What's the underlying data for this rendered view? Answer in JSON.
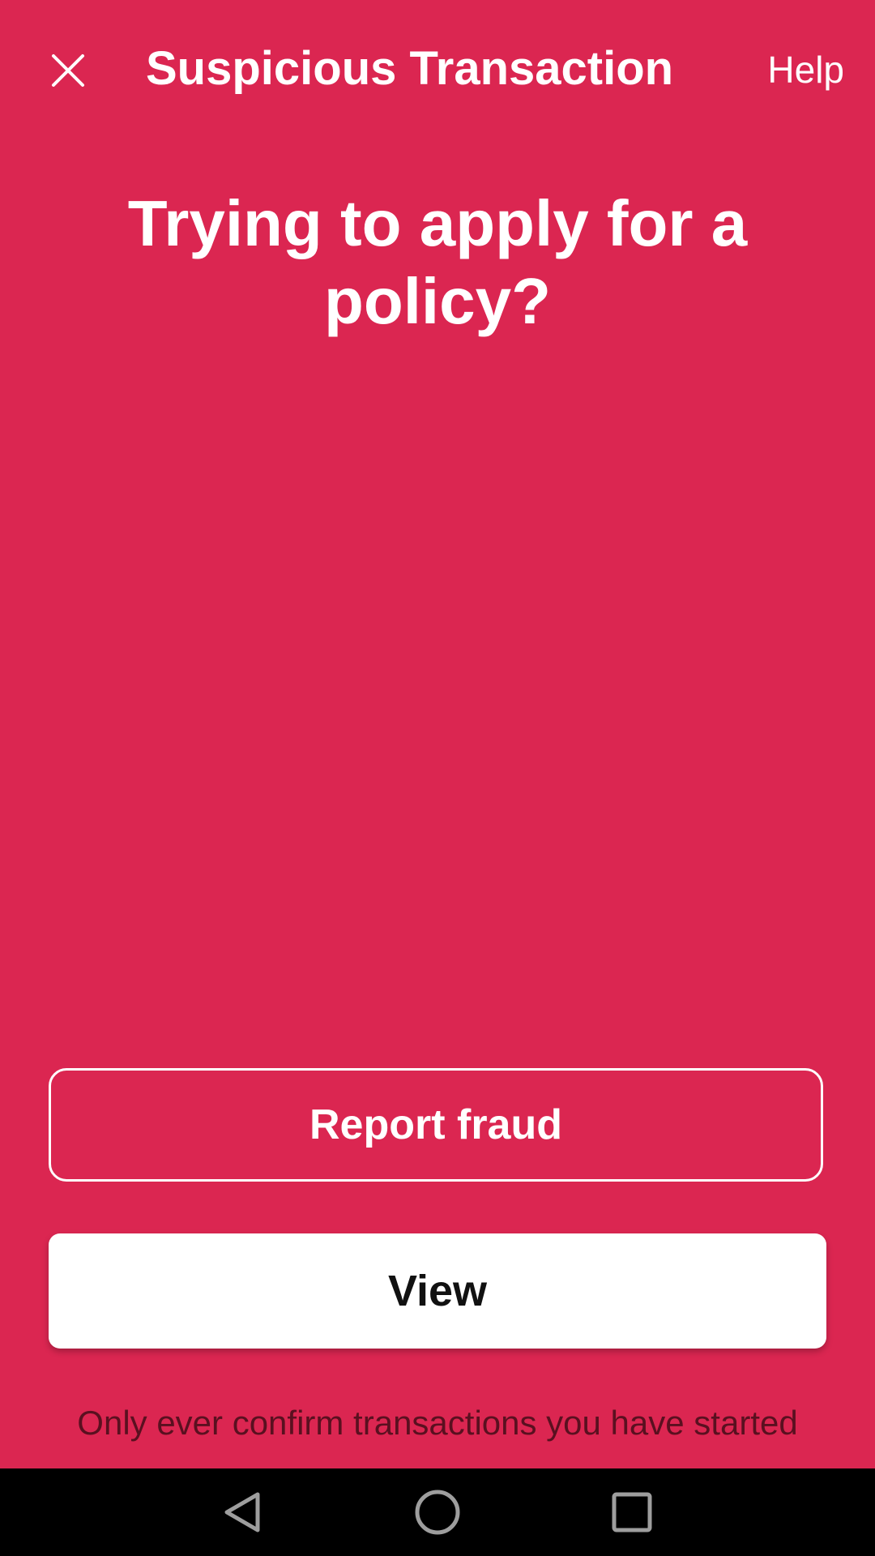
{
  "colors": {
    "background": "#db2651",
    "text_primary": "#ffffff",
    "button_fill": "#ffffff",
    "button_text": "#111111",
    "footer_text": "#5a1020",
    "nav_bar": "#000000",
    "nav_icon": "#9e9e9e"
  },
  "header": {
    "close_icon": "close-icon",
    "title": "Suspicious Transaction",
    "help_label": "Help"
  },
  "main": {
    "headline": "Trying to apply for a policy?"
  },
  "actions": {
    "report_label": "Report fraud",
    "view_label": "View"
  },
  "footer": {
    "note": "Only ever confirm transactions you have started"
  },
  "navbar": {
    "back_icon": "back-triangle-icon",
    "home_icon": "home-circle-icon",
    "recents_icon": "recents-square-icon"
  }
}
